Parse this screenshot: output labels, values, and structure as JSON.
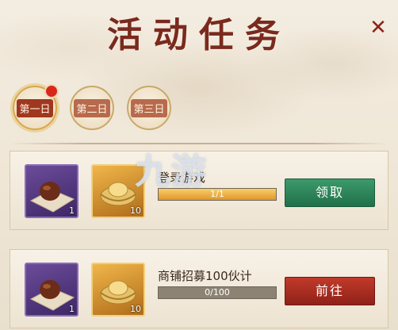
{
  "title": "活动任务",
  "close_symbol": "✕",
  "days": [
    {
      "label": "第一日",
      "active": true,
      "has_red_dot": true
    },
    {
      "label": "第二日",
      "active": false,
      "has_red_dot": false
    },
    {
      "label": "第三日",
      "active": false,
      "has_red_dot": false
    }
  ],
  "watermark": "九游",
  "tasks": [
    {
      "name": "登录游戏",
      "progress_text": "1/1",
      "progress": 1.0,
      "rewards": [
        {
          "icon": "chestnut-item-icon",
          "count": "1",
          "frame": "purple"
        },
        {
          "icon": "gold-ingot-icon",
          "count": "10",
          "frame": "gold"
        }
      ],
      "button_label": "领取",
      "button_color": "#2f8a5c"
    },
    {
      "name": "商铺招募100伙计",
      "progress_text": "0/100",
      "progress": 0.0,
      "rewards": [
        {
          "icon": "chestnut-item-icon",
          "count": "1",
          "frame": "purple"
        },
        {
          "icon": "gold-ingot-icon",
          "count": "10",
          "frame": "gold"
        }
      ],
      "button_label": "前往",
      "button_color": "#b5301f"
    }
  ],
  "colors": {
    "title": "#7a2a1d",
    "accent_red": "#a0371f",
    "claim_green": "#2f8a5c",
    "goto_red": "#b5301f",
    "progress_fill": "#e2962c"
  }
}
